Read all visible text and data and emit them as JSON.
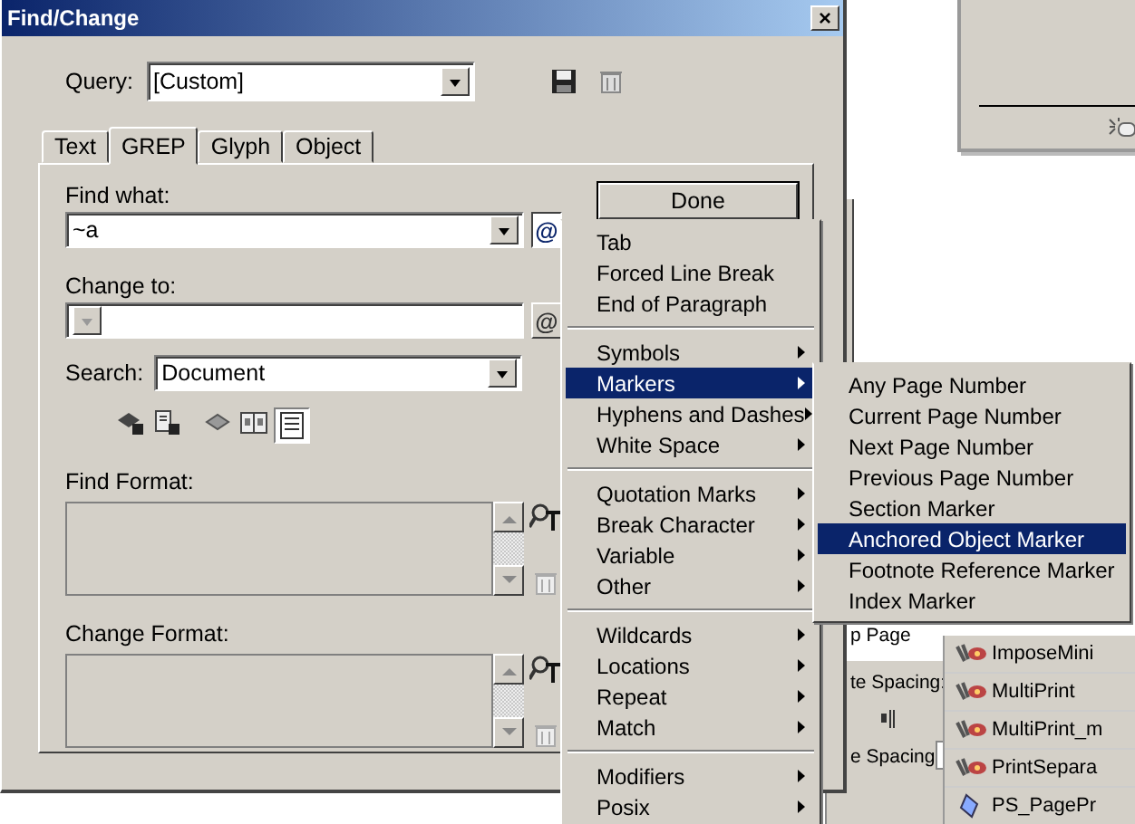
{
  "window": {
    "title": "Find/Change",
    "close": "×"
  },
  "query": {
    "label": "Query:",
    "value": "[Custom]"
  },
  "tabs": [
    {
      "label": "Text",
      "selected": false
    },
    {
      "label": "GREP",
      "selected": true
    },
    {
      "label": "Glyph",
      "selected": false
    },
    {
      "label": "Object",
      "selected": false
    }
  ],
  "find_what": {
    "label": "Find what:",
    "value": "~a",
    "button": "@"
  },
  "change_to": {
    "label": "Change to:",
    "button": "@"
  },
  "search": {
    "label": "Search:",
    "value": "Document"
  },
  "done_button": "Done",
  "search_options": [
    {
      "selected": false
    },
    {
      "selected": false
    },
    {
      "selected": false
    },
    {
      "selected": false
    },
    {
      "selected": true
    }
  ],
  "find_format": {
    "label": "Find Format:"
  },
  "change_format": {
    "label": "Change Format:"
  },
  "menu": {
    "groups": [
      [
        {
          "label": "Tab",
          "submenu": false,
          "selected": false
        },
        {
          "label": "Forced Line Break",
          "submenu": false,
          "selected": false
        },
        {
          "label": "End of Paragraph",
          "submenu": false,
          "selected": false
        }
      ],
      [
        {
          "label": "Symbols",
          "submenu": true,
          "selected": false
        },
        {
          "label": "Markers",
          "submenu": true,
          "selected": true
        },
        {
          "label": "Hyphens and Dashes",
          "submenu": true,
          "selected": false
        },
        {
          "label": "White Space",
          "submenu": true,
          "selected": false
        }
      ],
      [
        {
          "label": "Quotation Marks",
          "submenu": true,
          "selected": false
        },
        {
          "label": "Break Character",
          "submenu": true,
          "selected": false
        },
        {
          "label": "Variable",
          "submenu": true,
          "selected": false
        },
        {
          "label": "Other",
          "submenu": true,
          "selected": false
        }
      ],
      [
        {
          "label": "Wildcards",
          "submenu": true,
          "selected": false
        },
        {
          "label": "Locations",
          "submenu": true,
          "selected": false
        },
        {
          "label": "Repeat",
          "submenu": true,
          "selected": false
        },
        {
          "label": "Match",
          "submenu": true,
          "selected": false
        }
      ],
      [
        {
          "label": "Modifiers",
          "submenu": true,
          "selected": false
        },
        {
          "label": "Posix",
          "submenu": true,
          "selected": false
        }
      ]
    ]
  },
  "submenu": {
    "items": [
      {
        "label": "Any Page Number",
        "selected": false
      },
      {
        "label": "Current Page Number",
        "selected": false
      },
      {
        "label": "Next Page Number",
        "selected": false
      },
      {
        "label": "Previous Page Number",
        "selected": false
      },
      {
        "label": "Section Marker",
        "selected": false
      },
      {
        "label": "Anchored Object Marker",
        "selected": true
      },
      {
        "label": "Footnote Reference Marker",
        "selected": false
      },
      {
        "label": "Index Marker",
        "selected": false
      }
    ]
  },
  "paragraph_panel": {
    "labels": [
      "p Page",
      "te Spacing:",
      "e Spacing"
    ]
  },
  "scripts_panel": {
    "items": [
      {
        "label": "ImposeMini",
        "kind": "script"
      },
      {
        "label": "MultiPrint",
        "kind": "script"
      },
      {
        "label": "MultiPrint_m",
        "kind": "script"
      },
      {
        "label": "PrintSepara",
        "kind": "script"
      },
      {
        "label": "PS_PagePr",
        "kind": "javascript"
      }
    ]
  }
}
